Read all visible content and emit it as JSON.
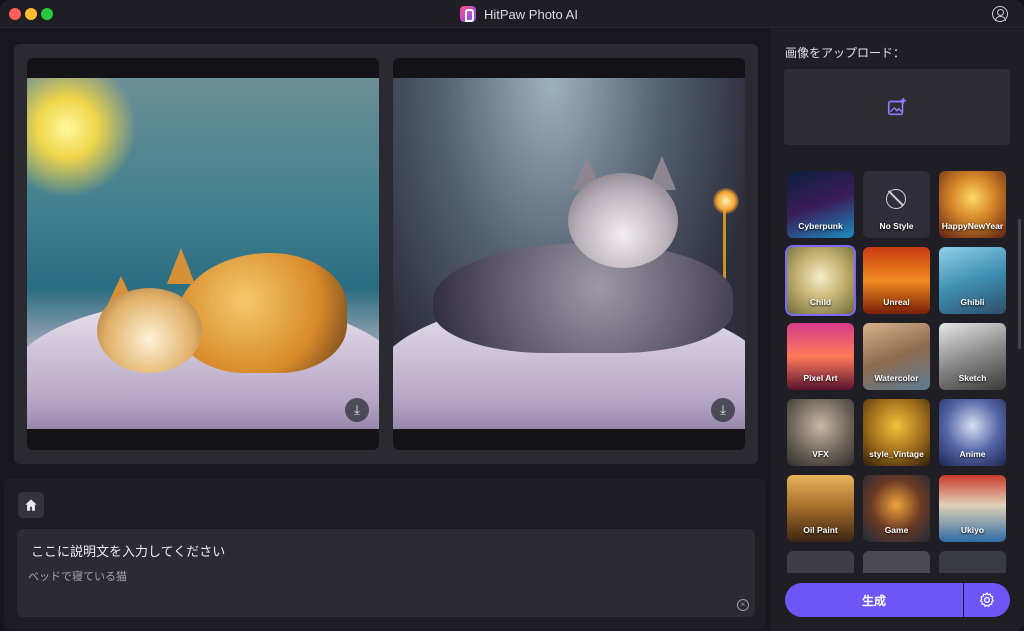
{
  "app": {
    "title": "HitPaw Photo AI"
  },
  "icons": {
    "logo": "hitpaw-logo-icon",
    "user": "user-icon",
    "home": "home-icon",
    "download": "download-icon",
    "upload": "image-upload-icon",
    "clear": "clear-icon",
    "settings": "gear-icon"
  },
  "colors": {
    "accent": "#6d55f6",
    "background": "#18171d",
    "panel": "#2b2a31"
  },
  "prompt": {
    "title": "ここに説明文を入力してください",
    "value": "ベッドで寝ている猫"
  },
  "sidebar": {
    "upload_label": "画像をアップロード：",
    "styles": [
      {
        "label": "Cyberpunk"
      },
      {
        "label": "No Style"
      },
      {
        "label": "HappyNewYear"
      },
      {
        "label": "Child",
        "selected": true
      },
      {
        "label": "Unreal"
      },
      {
        "label": "Ghibli"
      },
      {
        "label": "Pixel Art"
      },
      {
        "label": "Watercolor"
      },
      {
        "label": "Sketch"
      },
      {
        "label": "VFX"
      },
      {
        "label": "style_Vintage"
      },
      {
        "label": "Anime"
      },
      {
        "label": "Oil Paint"
      },
      {
        "label": "Game"
      },
      {
        "label": "Ukiyo"
      }
    ],
    "generate_label": "生成"
  }
}
